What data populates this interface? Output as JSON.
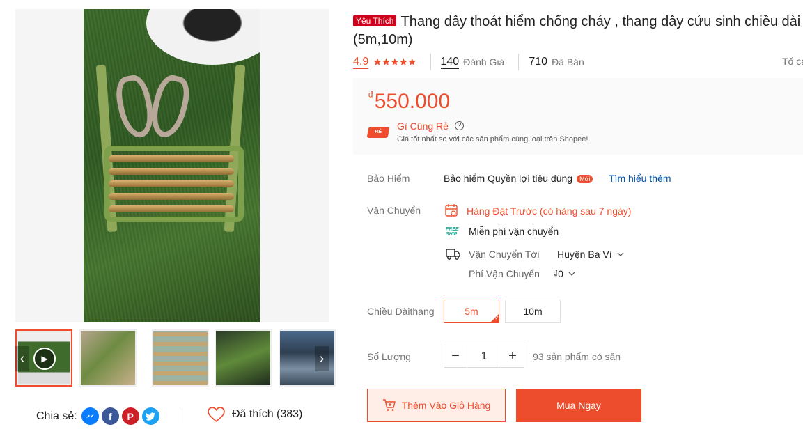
{
  "gallery": {
    "thumbnails": [
      "video-thumb",
      "product-thumb-1",
      "product-thumb-2",
      "product-thumb-3",
      "product-thumb-4"
    ],
    "prev_arrow": "‹",
    "next_arrow": "›"
  },
  "share": {
    "label": "Chia sẻ:",
    "networks": [
      "messenger-icon",
      "facebook-icon",
      "pinterest-icon",
      "twitter-icon"
    ],
    "facebook_glyph": "f",
    "pinterest_glyph": "P"
  },
  "like": {
    "label": "Đã thích (383)"
  },
  "product": {
    "badge": "Yêu Thích",
    "title": "Thang dây thoát hiểm chống cháy , thang dây cứu sinh chiều dài (5m,10m)"
  },
  "rating": {
    "score": "4.9",
    "stars": "★★★★★",
    "reviews_count": "140",
    "reviews_label": "Đánh Giá",
    "sold_count": "710",
    "sold_label": "Đã Bán",
    "report_label": "Tố cáo"
  },
  "price": {
    "currency": "₫",
    "value": "550.000",
    "promo_logo": "RẺ",
    "promo_title": "Gì Cũng Rẻ",
    "promo_desc": "Giá tốt nhất so với các sản phẩm cùng loại trên Shopee!"
  },
  "insurance": {
    "label": "Bảo Hiểm",
    "value": "Bảo hiểm Quyền lợi tiêu dùng",
    "new_badge": "Mới",
    "link": "Tìm hiểu thêm"
  },
  "shipping": {
    "label": "Vận Chuyển",
    "preorder": "Hàng Đặt Trước (có hàng sau 7 ngày)",
    "free_logo": "FREE SHIP",
    "free_text": "Miễn phí vận chuyển",
    "to_label": "Vận Chuyển Tới",
    "to_value": "Huyện Ba Vì",
    "fee_label": "Phí Vận Chuyển",
    "fee_value": "₫0"
  },
  "variation": {
    "label": "Chiều Dàithang",
    "options": [
      "5m",
      "10m"
    ],
    "selected": "5m"
  },
  "quantity": {
    "label": "Số Lượng",
    "minus": "−",
    "value": "1",
    "plus": "+",
    "stock": "93 sản phẩm có sẵn"
  },
  "actions": {
    "add_to_cart": "Thêm Vào Giỏ Hàng",
    "buy_now": "Mua Ngay"
  },
  "colors": {
    "accent": "#ee4d2d",
    "link": "#0055aa",
    "favorite_badge": "#d0011b"
  }
}
